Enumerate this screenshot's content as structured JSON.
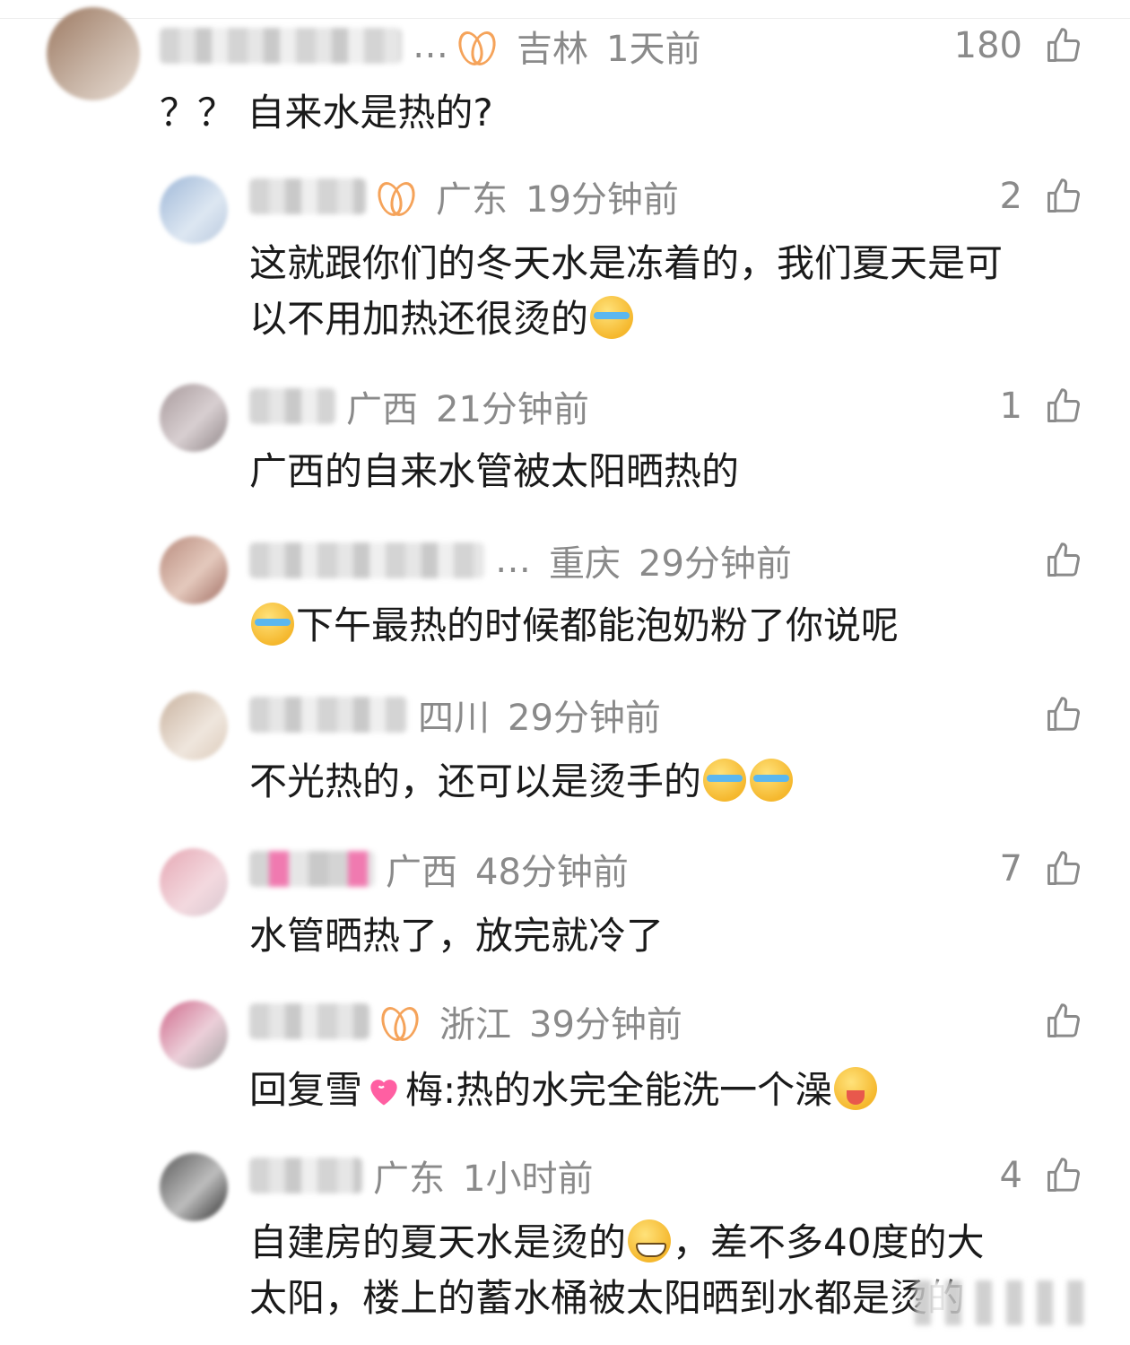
{
  "comments": [
    {
      "location": "吉林",
      "time": "1天前",
      "likes": "180",
      "text": "？？ 自来水是热的?",
      "ellipsis": "…",
      "avatar_colors": [
        "#9d7a63",
        "#c7b3a4"
      ]
    },
    {
      "location": "广东",
      "time": "19分钟前",
      "likes": "2",
      "text_line1": "这就跟你们的冬天水是冻着的，我们夏天是可",
      "text_line2": "以不用加热还很烫的",
      "avatar_colors": [
        "#9fb8d8",
        "#dde7f2"
      ]
    },
    {
      "location": "广西",
      "time": "21分钟前",
      "likes": "1",
      "text": "广西的自来水管被太阳晒热的",
      "avatar_colors": [
        "#a89a9c",
        "#d8cfd1"
      ]
    },
    {
      "location": "重庆",
      "time": "29分钟前",
      "likes": "",
      "text": "下午最热的时候都能泡奶粉了你说呢",
      "ellipsis": "…",
      "avatar_colors": [
        "#b98c7e",
        "#e4c9bd"
      ]
    },
    {
      "location": "四川",
      "time": "29分钟前",
      "likes": "",
      "text": "不光热的，还可以是烫手的",
      "avatar_colors": [
        "#c9b3a0",
        "#efe6dd"
      ]
    },
    {
      "location": "广西",
      "time": "48分钟前",
      "likes": "7",
      "text": "水管晒热了，放完就冷了",
      "avatar_colors": [
        "#e6a8b4",
        "#f3d9df"
      ]
    },
    {
      "location": "浙江",
      "time": "39分钟前",
      "likes": "",
      "text_prefix": "回复雪",
      "text_suffix": "梅:热的水完全能洗一个澡",
      "avatar_colors": [
        "#d06a8c",
        "#eccfd9"
      ]
    },
    {
      "location": "广东",
      "time": "1小时前",
      "likes": "4",
      "text_line1_a": "自建房的夏天水是烫的",
      "text_line1_b": "，差不多40度的大",
      "text_line2": "太阳，楼上的蓄水桶被太阳晒到水都是烫的",
      "avatar_colors": [
        "#5a5a5a",
        "#bdbdbd"
      ]
    }
  ],
  "icons": {
    "like": "thumbs-up-icon",
    "badge": "butterfly-badge-icon",
    "emoji_cry": "crying-laughing-emoji",
    "emoji_grin": "grinning-emoji",
    "emoji_drool": "drooling-emoji",
    "heart": "pink-heart-icon"
  },
  "colors": {
    "meta_gray": "#8a8a8a",
    "badge_orange": "#f5a35a",
    "heart_pink": "#ff5fa2"
  }
}
